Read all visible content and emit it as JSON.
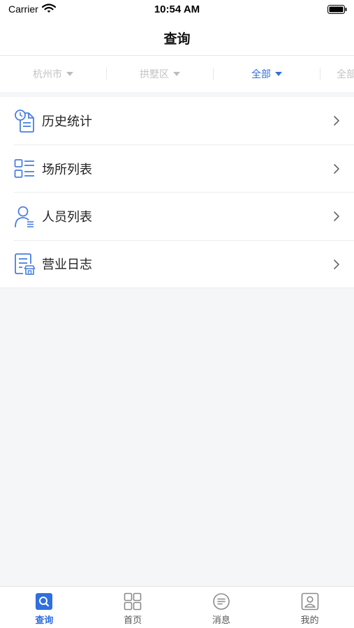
{
  "status_bar": {
    "carrier": "Carrier",
    "time": "10:54 AM"
  },
  "nav": {
    "title": "查询"
  },
  "filters": [
    {
      "label": "杭州市",
      "active": false
    },
    {
      "label": "拱墅区",
      "active": false
    },
    {
      "label": "全部",
      "active": true
    },
    {
      "label": "全部",
      "active": false
    }
  ],
  "menu": [
    {
      "label": "历史统计",
      "icon": "history-stats-icon"
    },
    {
      "label": "场所列表",
      "icon": "venue-list-icon"
    },
    {
      "label": "人员列表",
      "icon": "person-list-icon"
    },
    {
      "label": "营业日志",
      "icon": "business-log-icon"
    }
  ],
  "tabs": [
    {
      "label": "查询",
      "icon": "search-icon",
      "active": true
    },
    {
      "label": "首页",
      "icon": "home-grid-icon",
      "active": false
    },
    {
      "label": "消息",
      "icon": "message-icon",
      "active": false
    },
    {
      "label": "我的",
      "icon": "profile-icon",
      "active": false
    }
  ],
  "colors": {
    "accent": "#2f6fe0",
    "icon_blue": "#4a7fe0",
    "background": "#f5f6f8"
  }
}
